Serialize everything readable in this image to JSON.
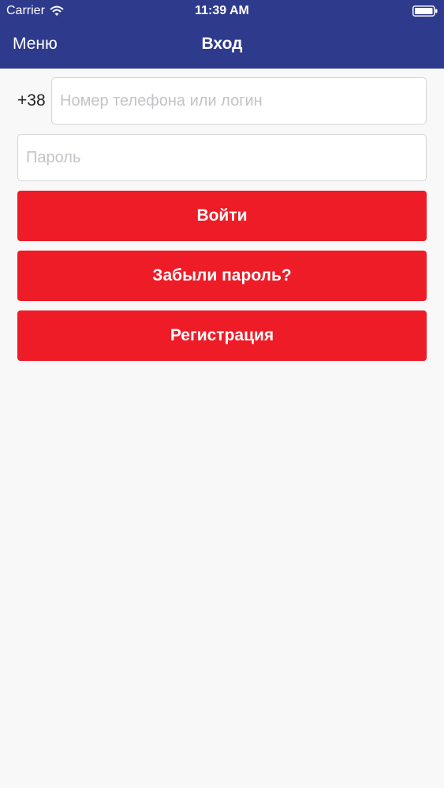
{
  "status_bar": {
    "carrier": "Carrier",
    "time": "11:39 AM"
  },
  "nav": {
    "menu_label": "Меню",
    "title": "Вход"
  },
  "login_form": {
    "phone_prefix": "+38",
    "phone_placeholder": "Номер телефона или логин",
    "phone_value": "",
    "password_placeholder": "Пароль",
    "password_value": "",
    "login_label": "Войти",
    "forgot_label": "Забыли пароль?",
    "register_label": "Регистрация"
  },
  "colors": {
    "nav_background": "#2e3a8c",
    "button_red": "#ee1c27",
    "page_background": "#f8f8f8"
  },
  "icons": {
    "wifi": "wifi-icon",
    "battery": "battery-icon"
  }
}
